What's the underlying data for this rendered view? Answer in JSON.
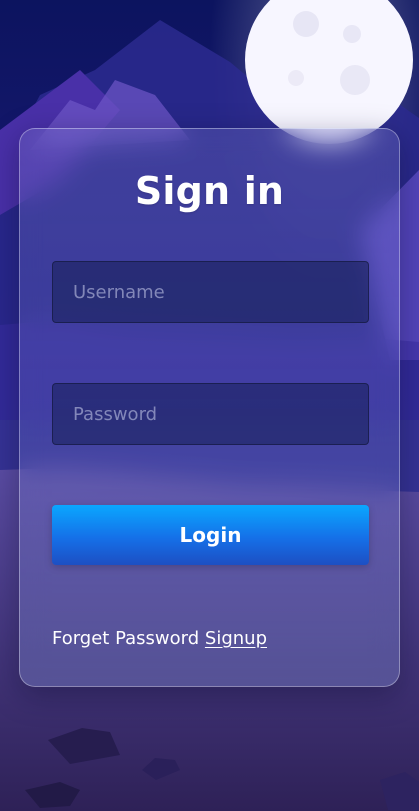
{
  "login": {
    "title": "Sign in",
    "username_placeholder": "Username",
    "password_placeholder": "Password",
    "login_button": "Login",
    "forget_password_link": "Forget Password",
    "signup_link": "Signup"
  },
  "colors": {
    "accent_top": "#0aa7ff",
    "accent_bottom": "#1d4fc3",
    "night_top": "#0d1565",
    "night_bottom": "#2a1f66",
    "moon": "#f8f8ff"
  }
}
